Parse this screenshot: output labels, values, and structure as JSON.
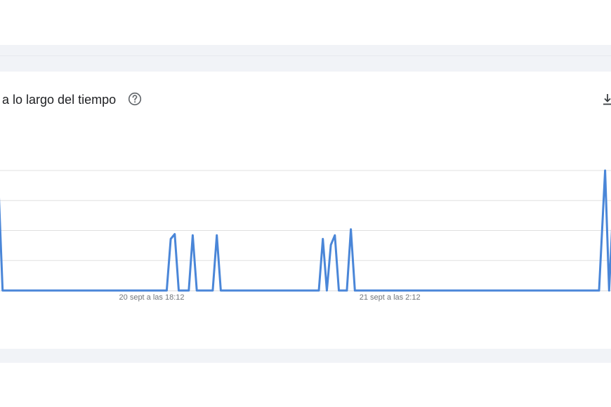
{
  "header": {
    "title": "a lo largo del tiempo",
    "help_icon": "help-circle-icon",
    "download_icon": "download-icon"
  },
  "colors": {
    "series": "#4a86d8",
    "grid": "#e0e0e0",
    "baseline": "#dadce0",
    "band": "#f1f3f7",
    "text": "#202124",
    "tick_text": "#70757a"
  },
  "chart_data": {
    "type": "line",
    "title": "",
    "xlabel": "",
    "ylabel": "",
    "ylim": [
      0,
      100
    ],
    "grid": true,
    "x_tick_labels": [
      "20 sept a las 18:12",
      "21 sept a las 2:12"
    ],
    "x_tick_index": [
      76.5,
      195.5
    ],
    "series": [
      {
        "name": "",
        "points": [
          [
            0,
            85
          ],
          [
            2,
            0
          ],
          [
            84,
            0
          ],
          [
            86,
            43
          ],
          [
            88,
            47
          ],
          [
            90,
            0
          ],
          [
            95,
            0
          ],
          [
            97,
            46
          ],
          [
            99,
            0
          ],
          [
            107,
            0
          ],
          [
            109,
            46
          ],
          [
            111,
            0
          ],
          [
            160,
            0
          ],
          [
            162,
            43
          ],
          [
            164,
            0
          ],
          [
            166,
            38
          ],
          [
            168,
            46
          ],
          [
            170,
            0
          ],
          [
            174,
            0
          ],
          [
            176,
            51
          ],
          [
            178,
            0
          ],
          [
            300,
            0
          ],
          [
            303,
            100
          ],
          [
            305,
            0
          ],
          [
            307,
            70
          ],
          [
            310,
            69
          ]
        ]
      }
    ]
  }
}
